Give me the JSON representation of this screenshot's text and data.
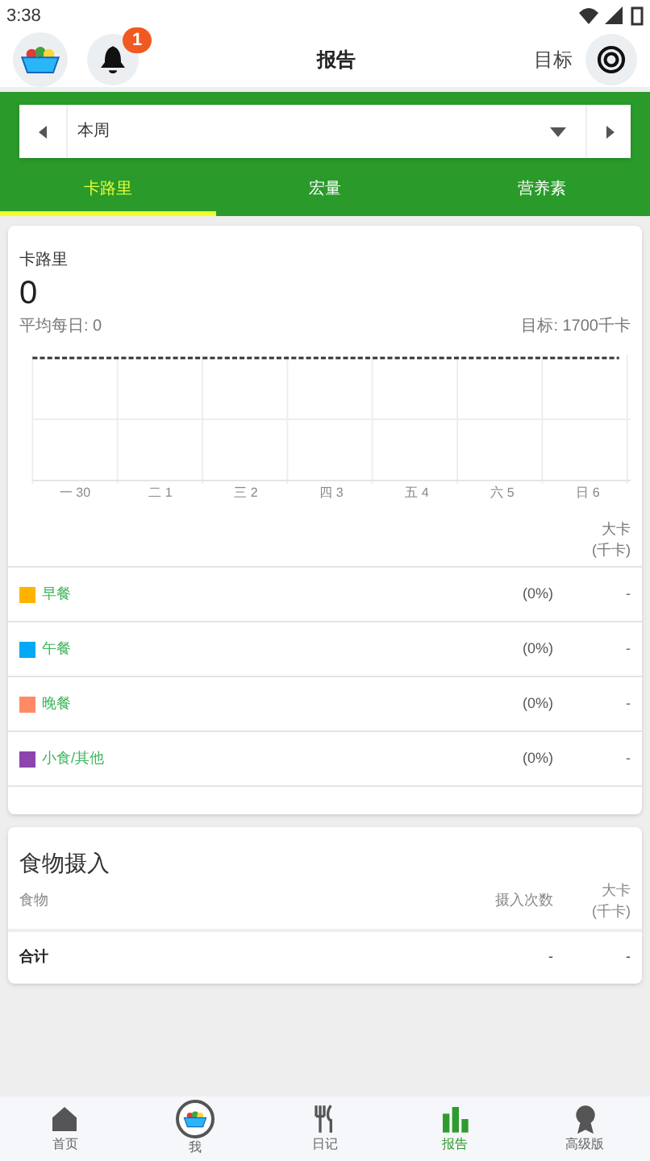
{
  "status_bar": {
    "time": "3:38"
  },
  "header": {
    "title": "报告",
    "notification_count": "1",
    "goal_label": "目标"
  },
  "period_selector": {
    "value": "本周"
  },
  "tabs": [
    {
      "label": "卡路里",
      "selected": true
    },
    {
      "label": "宏量",
      "selected": false
    },
    {
      "label": "营养素",
      "selected": false
    }
  ],
  "calories_card": {
    "title": "卡路里",
    "total": "0",
    "average": "平均每日: 0",
    "goal": "目标: 1700千卡",
    "x_labels": [
      "一 30",
      "二 1",
      "三 2",
      "四 3",
      "五 4",
      "六 5",
      "日 6"
    ],
    "unit_line1": "大卡",
    "unit_line2": "(千卡)",
    "meals": [
      {
        "name": "早餐",
        "color": "#ffb300",
        "percent": "(0%)",
        "value": "-"
      },
      {
        "name": "午餐",
        "color": "#03a9f4",
        "percent": "(0%)",
        "value": "-"
      },
      {
        "name": "晚餐",
        "color": "#ff8a65",
        "percent": "(0%)",
        "value": "-"
      },
      {
        "name": "小食/其他",
        "color": "#8e44ad",
        "percent": "(0%)",
        "value": "-"
      }
    ]
  },
  "food_card": {
    "title": "食物摄入",
    "columns": [
      "食物",
      "摄入次数",
      "大卡\n(千卡)"
    ],
    "total_row": {
      "label": "合计",
      "count": "-",
      "value": "-"
    }
  },
  "bottom_nav": [
    {
      "label": "首页",
      "kind": "home",
      "selected": false
    },
    {
      "label": "我",
      "kind": "me",
      "selected": false
    },
    {
      "label": "日记",
      "kind": "diary",
      "selected": false
    },
    {
      "label": "报告",
      "kind": "report",
      "selected": true
    },
    {
      "label": "高级版",
      "kind": "premium",
      "selected": false
    }
  ]
}
